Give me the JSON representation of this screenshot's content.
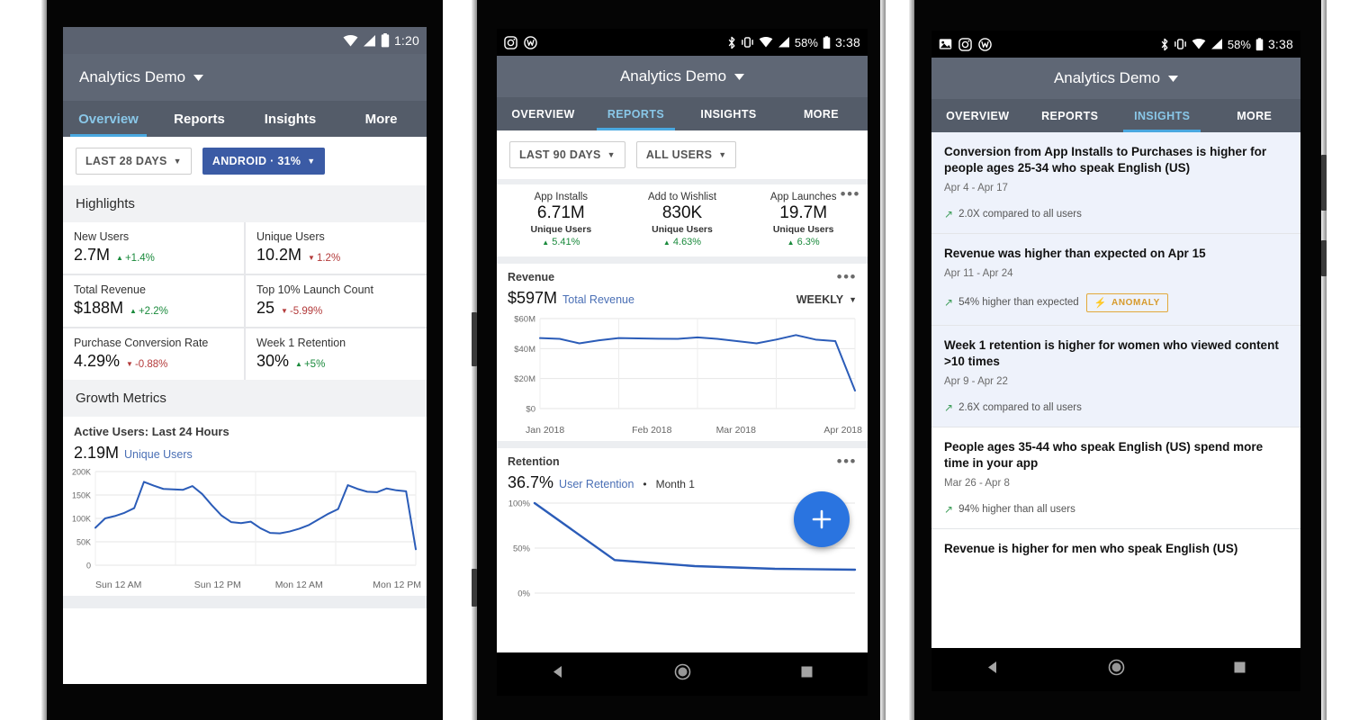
{
  "phone1": {
    "statusbar": {
      "time": "1:20",
      "icons": [
        "wifi-icon",
        "signal-icon",
        "battery-icon"
      ]
    },
    "appbar": {
      "title": "Analytics Demo"
    },
    "tabs": [
      {
        "label": "Overview",
        "active": true
      },
      {
        "label": "Reports",
        "active": false
      },
      {
        "label": "Insights",
        "active": false
      },
      {
        "label": "More",
        "active": false
      }
    ],
    "filters": [
      {
        "label": "LAST 28 DAYS",
        "solid": false
      },
      {
        "label": "ANDROID · 31%",
        "solid": true
      }
    ],
    "highlights_header": "Highlights",
    "highlights": [
      {
        "label": "New Users",
        "value": "2.7M",
        "delta": "+1.4%",
        "dir": "up"
      },
      {
        "label": "Unique Users",
        "value": "10.2M",
        "delta": "1.2%",
        "dir": "down"
      },
      {
        "label": "Total Revenue",
        "value": "$188M",
        "delta": "+2.2%",
        "dir": "up"
      },
      {
        "label": "Top 10% Launch Count",
        "value": "25",
        "delta": "-5.99%",
        "dir": "down"
      },
      {
        "label": "Purchase Conversion Rate",
        "value": "4.29%",
        "delta": "-0.88%",
        "dir": "down"
      },
      {
        "label": "Week 1 Retention",
        "value": "30%",
        "delta": "+5%",
        "dir": "up"
      }
    ],
    "growth_header": "Growth Metrics",
    "chart_card": {
      "title": "Active Users: Last 24 Hours",
      "value": "2.19M",
      "value_sub": "Unique Users"
    }
  },
  "phone2": {
    "statusbar": {
      "time": "3:38",
      "battery_pct": "58%",
      "left_icons": [
        "instagram-icon",
        "workplace-icon"
      ],
      "right_icons": [
        "bluetooth-icon",
        "vibrate-icon",
        "wifi-icon",
        "signal-icon",
        "battery-icon"
      ]
    },
    "appbar": {
      "title": "Analytics Demo"
    },
    "tabs": [
      {
        "label": "OVERVIEW",
        "active": false
      },
      {
        "label": "REPORTS",
        "active": true
      },
      {
        "label": "INSIGHTS",
        "active": false
      },
      {
        "label": "MORE",
        "active": false
      }
    ],
    "filters": [
      {
        "label": "LAST 90 DAYS",
        "solid": false
      },
      {
        "label": "ALL USERS",
        "solid": false
      }
    ],
    "metrics": [
      {
        "label": "App Installs",
        "value": "6.71M",
        "sub": "Unique Users",
        "delta": "5.41%",
        "dir": "up"
      },
      {
        "label": "Add to Wishlist",
        "value": "830K",
        "sub": "Unique Users",
        "delta": "4.63%",
        "dir": "up"
      },
      {
        "label": "App Launches",
        "value": "19.7M",
        "sub": "Unique Users",
        "delta": "6.3%",
        "dir": "up"
      }
    ],
    "revenue_card": {
      "title": "Revenue",
      "value": "$597M",
      "value_sub": "Total Revenue",
      "period": "WEEKLY"
    },
    "retention_card": {
      "title": "Retention",
      "value": "36.7%",
      "value_sub": "User Retention",
      "separator": "•",
      "value_sub2": "Month 1"
    },
    "fab": {
      "icon": "plus-icon"
    },
    "navbar": [
      "back-icon",
      "home-icon",
      "recents-icon"
    ]
  },
  "phone3": {
    "statusbar": {
      "time": "3:38",
      "battery_pct": "58%",
      "left_icons": [
        "photo-icon",
        "instagram-icon",
        "workplace-icon"
      ],
      "right_icons": [
        "bluetooth-icon",
        "vibrate-icon",
        "wifi-icon",
        "signal-icon",
        "battery-icon"
      ]
    },
    "appbar": {
      "title": "Analytics Demo"
    },
    "tabs": [
      {
        "label": "OVERVIEW",
        "active": false
      },
      {
        "label": "REPORTS",
        "active": false
      },
      {
        "label": "INSIGHTS",
        "active": true
      },
      {
        "label": "MORE",
        "active": false
      }
    ],
    "insights": [
      {
        "title": "Conversion from App Installs to Purchases is higher for people ages 25-34 who speak English (US)",
        "date": "Apr 4 - Apr 17",
        "metric": "2.0X compared to all users",
        "badge": null
      },
      {
        "title": "Revenue was higher than expected on Apr 15",
        "date": "Apr 11 - Apr 24",
        "metric": "54% higher than expected",
        "badge": "ANOMALY"
      },
      {
        "title": "Week 1 retention is higher for women who viewed content >10 times",
        "date": "Apr 9 - Apr 22",
        "metric": "2.6X compared to all users",
        "badge": null
      },
      {
        "title": "People ages 35-44 who speak English (US) spend more time in your app",
        "date": "Mar 26 - Apr 8",
        "metric": "94% higher than all users",
        "badge": null
      },
      {
        "title": "Revenue is higher for men who speak English (US)",
        "date": "",
        "metric": "",
        "badge": null
      }
    ],
    "navbar": [
      "back-icon",
      "home-icon",
      "recents-icon"
    ]
  },
  "chart_data": [
    {
      "type": "line",
      "title": "Active Users: Last 24 Hours",
      "ylabel": "",
      "xlabel": "",
      "yticks": [
        "200K",
        "150K",
        "100K",
        "50K",
        "0"
      ],
      "ylim": [
        0,
        200000
      ],
      "xticks": [
        "Sun 12 AM",
        "Sun 12 PM",
        "Mon 12 AM",
        "Mon 12 PM"
      ],
      "series": [
        {
          "name": "Unique Users",
          "color": "#2b5cb8",
          "values": [
            80000,
            100000,
            105000,
            112000,
            122000,
            178000,
            170000,
            163000,
            162000,
            161000,
            169000,
            152000,
            128000,
            106000,
            92000,
            90000,
            93000,
            79000,
            69000,
            68000,
            72000,
            78000,
            86000,
            98000,
            110000,
            120000,
            171000,
            163000,
            157000,
            156000,
            164000,
            160000,
            158000,
            34000
          ]
        }
      ],
      "grid": true
    },
    {
      "type": "line",
      "title": "Revenue",
      "ylabel": "",
      "xlabel": "",
      "yticks": [
        "$60M",
        "$40M",
        "$20M",
        "$0"
      ],
      "ylim": [
        0,
        60000000
      ],
      "xticks": [
        "Jan 2018",
        "Feb 2018",
        "Mar 2018",
        "Apr 2018"
      ],
      "series": [
        {
          "name": "Total Revenue",
          "color": "#2b5cb8",
          "values": [
            47000000,
            46500000,
            43500000,
            45500000,
            47000000,
            46800000,
            46600000,
            46500000,
            47500000,
            46500000,
            45000000,
            43500000,
            46000000,
            49000000,
            46000000,
            45000000,
            12000000
          ]
        }
      ],
      "grid": true
    },
    {
      "type": "line",
      "title": "Retention",
      "ylabel": "",
      "xlabel": "",
      "yticks": [
        "100%",
        "50%",
        "0%"
      ],
      "ylim": [
        0,
        100
      ],
      "xticks": [],
      "series": [
        {
          "name": "User Retention",
          "color": "#2b5cb8",
          "values": [
            100,
            36.7,
            30,
            27,
            26
          ]
        }
      ],
      "grid": true
    }
  ]
}
